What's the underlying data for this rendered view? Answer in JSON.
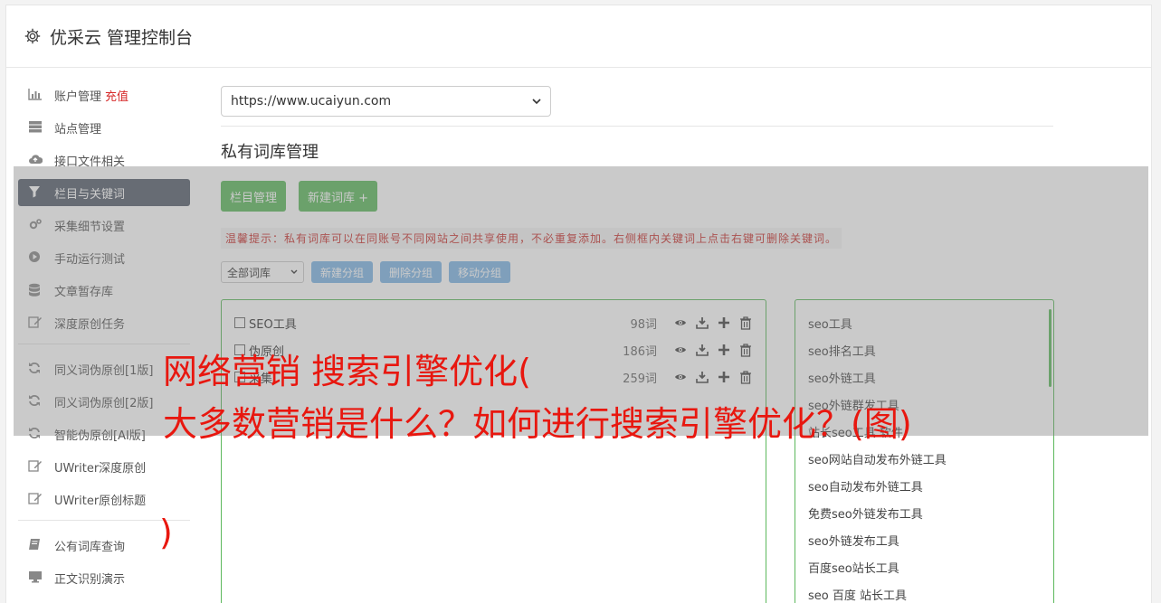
{
  "header": {
    "icon": "gear-icon",
    "title": "优采云 管理控制台"
  },
  "sidebar": {
    "group1": [
      {
        "icon": "bar-chart-icon",
        "label": "账户管理",
        "badge": "充值"
      },
      {
        "icon": "server-icon",
        "label": "站点管理"
      },
      {
        "icon": "cloud-upload-icon",
        "label": "接口文件相关"
      },
      {
        "icon": "filter-icon",
        "label": "栏目与关键词",
        "active": true
      },
      {
        "icon": "gears-icon",
        "label": "采集细节设置"
      },
      {
        "icon": "play-circle-icon",
        "label": "手动运行测试"
      },
      {
        "icon": "database-icon",
        "label": "文章暂存库"
      },
      {
        "icon": "edit-icon",
        "label": "深度原创任务"
      }
    ],
    "group2": [
      {
        "icon": "refresh-icon",
        "label": "同义词伪原创[1版]"
      },
      {
        "icon": "refresh-icon",
        "label": "同义词伪原创[2版]"
      },
      {
        "icon": "refresh-icon",
        "label": "智能伪原创[AI版]"
      },
      {
        "icon": "edit-icon",
        "label": "UWriter深度原创"
      },
      {
        "icon": "edit-icon",
        "label": "UWriter原创标题"
      }
    ],
    "group3": [
      {
        "icon": "book-icon",
        "label": "公有词库查询"
      },
      {
        "icon": "monitor-icon",
        "label": "正文识别演示"
      }
    ]
  },
  "main": {
    "site_select": "https://www.ucaiyun.com",
    "section_title": "私有词库管理",
    "btn_column": "栏目管理",
    "btn_new_lib": "新建词库 +",
    "tip": "温馨提示：私有词库可以在同账号不同网站之间共享使用，不必重复添加。右侧框内关键词上点击右键可删除关键词。",
    "filter_select": "全部词库",
    "btn_new_group": "新建分组",
    "btn_delete_group": "删除分组",
    "btn_move_group": "移动分组",
    "libraries": [
      {
        "name": "SEO工具",
        "count": "98词"
      },
      {
        "name": "伪原创",
        "count": "186词"
      },
      {
        "name": "采集",
        "count": "259词"
      }
    ],
    "keywords": [
      "seo工具",
      "seo排名工具",
      "seo外链工具",
      "seo外链群发工具",
      "站长seo工具 软件",
      "seo网站自动发布外链工具",
      "seo自动发布外链工具",
      "免费seo外链发布工具",
      "seo外链发布工具",
      "百度seo站长工具",
      "seo 百度 站长工具"
    ]
  },
  "overlay_text": {
    "line1": "网络营销 搜索引擎优化(",
    "line2": "大多数营销是什么？如何进行搜索引擎优化？(图)",
    "line3": ")"
  },
  "colors": {
    "accent_green": "#5cb85c",
    "active_nav": "#555d6b",
    "headline_red": "#e8170f"
  }
}
